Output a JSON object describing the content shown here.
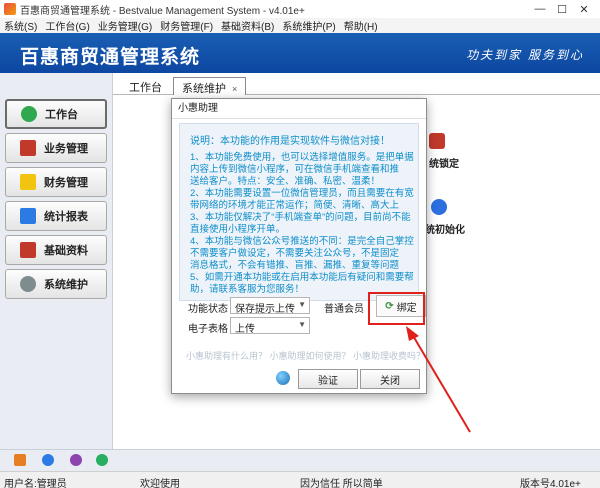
{
  "window": {
    "title": "百惠商贸通管理系统 - Bestvalue Management System - v4.01e+",
    "controls": [
      "—",
      "☐",
      "✕"
    ]
  },
  "menu": [
    "系统(S)",
    "工作台(G)",
    "业务管理(G)",
    "财务管理(F)",
    "基础资料(B)",
    "系统维护(P)",
    "帮助(H)"
  ],
  "banner": {
    "brand": "百惠商贸通管理系统",
    "slogan": "功夫到家 服务到心"
  },
  "sidebar": {
    "items": [
      {
        "label": "工作台",
        "icon": "check-circle-icon",
        "color": "#2fa84f"
      },
      {
        "label": "业务管理",
        "icon": "truck-icon",
        "color": "#c0392b"
      },
      {
        "label": "财务管理",
        "icon": "folder-icon",
        "color": "#f1c40f"
      },
      {
        "label": "统计报表",
        "icon": "bar-chart-icon",
        "color": "#2c7be5"
      },
      {
        "label": "基础资料",
        "icon": "book-icon",
        "color": "#c0392b"
      },
      {
        "label": "系统维护",
        "icon": "gear-icon",
        "color": "#7f8c8d"
      }
    ]
  },
  "tabs": {
    "workbench": "工作台",
    "active": "系统维护",
    "close": "×"
  },
  "background_items": {
    "lock": "统锁定",
    "init": "统初始化"
  },
  "dialog": {
    "title": "小惠助理",
    "heading": "说明：本功能的作用是实现软件与微信对接！",
    "lines": [
      "1、本功能免费使用，也可以选择增值服务。是把单据",
      "   内容上传到微信小程序，可在微信手机端查看和推",
      "   送给客户。特点：安全、准确、私密、温柔！",
      "2、本功能需要设置一位微信管理员，而且需要在有宽",
      "   带网络的环境才能正常运作；简便、清晰、高大上",
      "3、本功能仅解决了“手机端查单”的问题，目前尚不能",
      "   直接使用小程序开单。",
      "4、本功能与微信公众号推送的不同：是完全自己掌控",
      "   不需要客户做设定，不需要关注公众号，不是固定",
      "   消息格式，不会有错推、盲推、漏推、重复等问题",
      "5、如需开通本功能或在启用本功能后有疑问和需要帮",
      "   助，请联系客服为您服务！"
    ],
    "status_label": "功能状态",
    "status_value": "保存提示上传",
    "sheet_label": "电子表格",
    "sheet_value": "上传",
    "member": "普通会员",
    "bind_button": "绑定",
    "help_links": "小惠助理有什么用？ 小惠助理如何使用？ 小惠助理收费吗？",
    "verify_button": "验证",
    "close_button": "关闭"
  },
  "statusbar": {
    "user": "用户名:管理员",
    "welcome": "欢迎使用",
    "motto": "因为信任 所以简单",
    "version": "版本号4.01e+"
  },
  "colors": {
    "banner": "#1a5fb4",
    "dialog_text": "#0d8ec9",
    "annotation": "#e0201b"
  }
}
